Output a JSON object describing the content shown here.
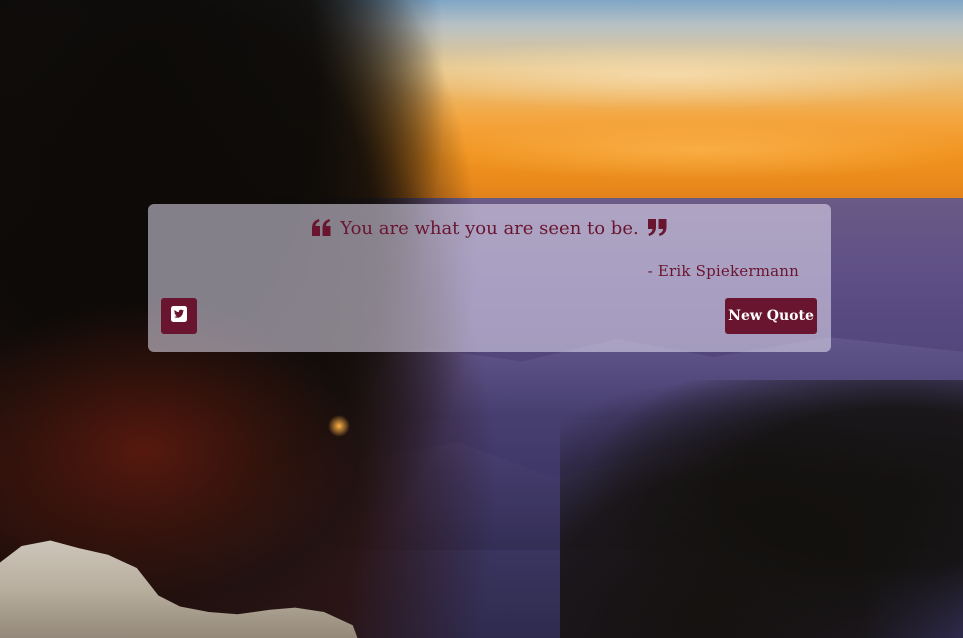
{
  "quote": {
    "text": "You are what you are seen to be.",
    "author": "- Erik Spiekermann",
    "open_icon": "quote-left-icon",
    "close_icon": "quote-right-icon"
  },
  "actions": {
    "tweet_icon": "twitter-square-icon",
    "new_quote_label": "New Quote"
  },
  "colors": {
    "accent": "#6a1530",
    "card_background": "rgba(232,226,244,0.55)",
    "button_text": "#ffffff"
  },
  "background": {
    "description_icon": "sunset-canyon-background"
  }
}
